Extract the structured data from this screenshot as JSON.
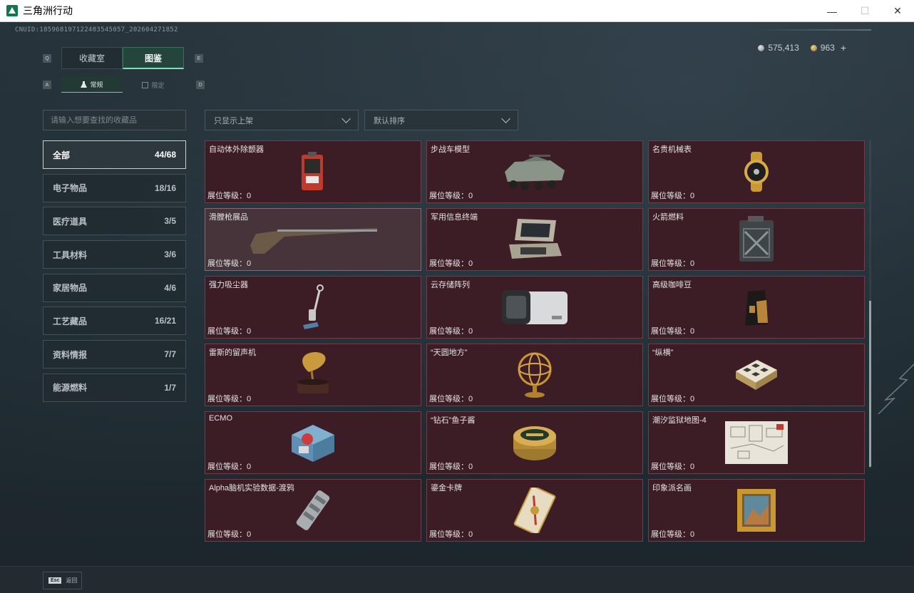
{
  "window": {
    "title": "三角洲行动",
    "minimize": "—",
    "maximize": "☐",
    "close": "✕"
  },
  "header": {
    "uid": "CNUID:1859681971224035450​57_202604271852",
    "silver": "575,413",
    "gold": "963",
    "plus": "+"
  },
  "tabs": {
    "key_left": "Q",
    "key_right": "E",
    "items": [
      {
        "label": "收藏室",
        "active": false
      },
      {
        "label": "图鉴",
        "active": true
      }
    ]
  },
  "subtabs": {
    "key_left": "A",
    "key_right": "D",
    "items": [
      {
        "label": "常规",
        "icon": "flask-icon",
        "active": true
      },
      {
        "label": "限定",
        "icon": "limited-icon",
        "active": false
      }
    ]
  },
  "search": {
    "placeholder": "请输入想要查找的收藏品"
  },
  "filters": {
    "shelf": "只显示上架",
    "sort": "默认排序"
  },
  "categories": [
    {
      "label": "全部",
      "count": "44/68",
      "active": true
    },
    {
      "label": "电子物品",
      "count": "18/16"
    },
    {
      "label": "医疗道具",
      "count": "3/5"
    },
    {
      "label": "工具材料",
      "count": "3/6"
    },
    {
      "label": "家居物品",
      "count": "4/6"
    },
    {
      "label": "工艺藏品",
      "count": "16/21"
    },
    {
      "label": "资料情报",
      "count": "7/7"
    },
    {
      "label": "能源燃料",
      "count": "1/7"
    }
  ],
  "items": [
    {
      "name": "自动体外除颤器",
      "level": "展位等级：0",
      "icon": "defibrillator-icon"
    },
    {
      "name": "步战车模型",
      "level": "展位等级：0",
      "icon": "ifv-model-icon"
    },
    {
      "name": "名贵机械表",
      "level": "展位等级：0",
      "icon": "gold-watch-icon"
    },
    {
      "name": "滑膛枪展品",
      "level": "展位等级：0",
      "icon": "musket-icon"
    },
    {
      "name": "军用信息终端",
      "level": "展位等级：0",
      "icon": "military-terminal-icon"
    },
    {
      "name": "火箭燃料",
      "level": "展位等级：0",
      "icon": "fuel-canister-icon"
    },
    {
      "name": "强力吸尘器",
      "level": "展位等级：0",
      "icon": "vacuum-icon"
    },
    {
      "name": "云存储阵列",
      "level": "展位等级：0",
      "icon": "storage-array-icon"
    },
    {
      "name": "高级咖啡豆",
      "level": "展位等级：0",
      "icon": "coffee-bag-icon"
    },
    {
      "name": "雷斯的留声机",
      "level": "展位等级：0",
      "icon": "gramophone-icon"
    },
    {
      "name": "“天圆地方”",
      "level": "展位等级：0",
      "icon": "armillary-sphere-icon"
    },
    {
      "name": "“纵横”",
      "level": "展位等级：0",
      "icon": "chessboard-icon"
    },
    {
      "name": "ECMO",
      "level": "展位等级：0",
      "icon": "ecmo-machine-icon"
    },
    {
      "name": "“钻石”鱼子酱",
      "level": "展位等级：0",
      "icon": "caviar-tin-icon"
    },
    {
      "name": "潮汐监狱地图-4",
      "level": "展位等级：0",
      "icon": "prison-map-icon"
    },
    {
      "name": "Alpha脑机实验数据-渡鸦",
      "level": "展位等级：0",
      "icon": "data-canister-icon"
    },
    {
      "name": "鎏金卡牌",
      "level": "展位等级：0",
      "icon": "gilded-card-icon"
    },
    {
      "name": "印象派名画",
      "level": "展位等级：0",
      "icon": "framed-painting-icon"
    }
  ],
  "footer": {
    "esc_key": "Esc",
    "back_label": "返回"
  }
}
